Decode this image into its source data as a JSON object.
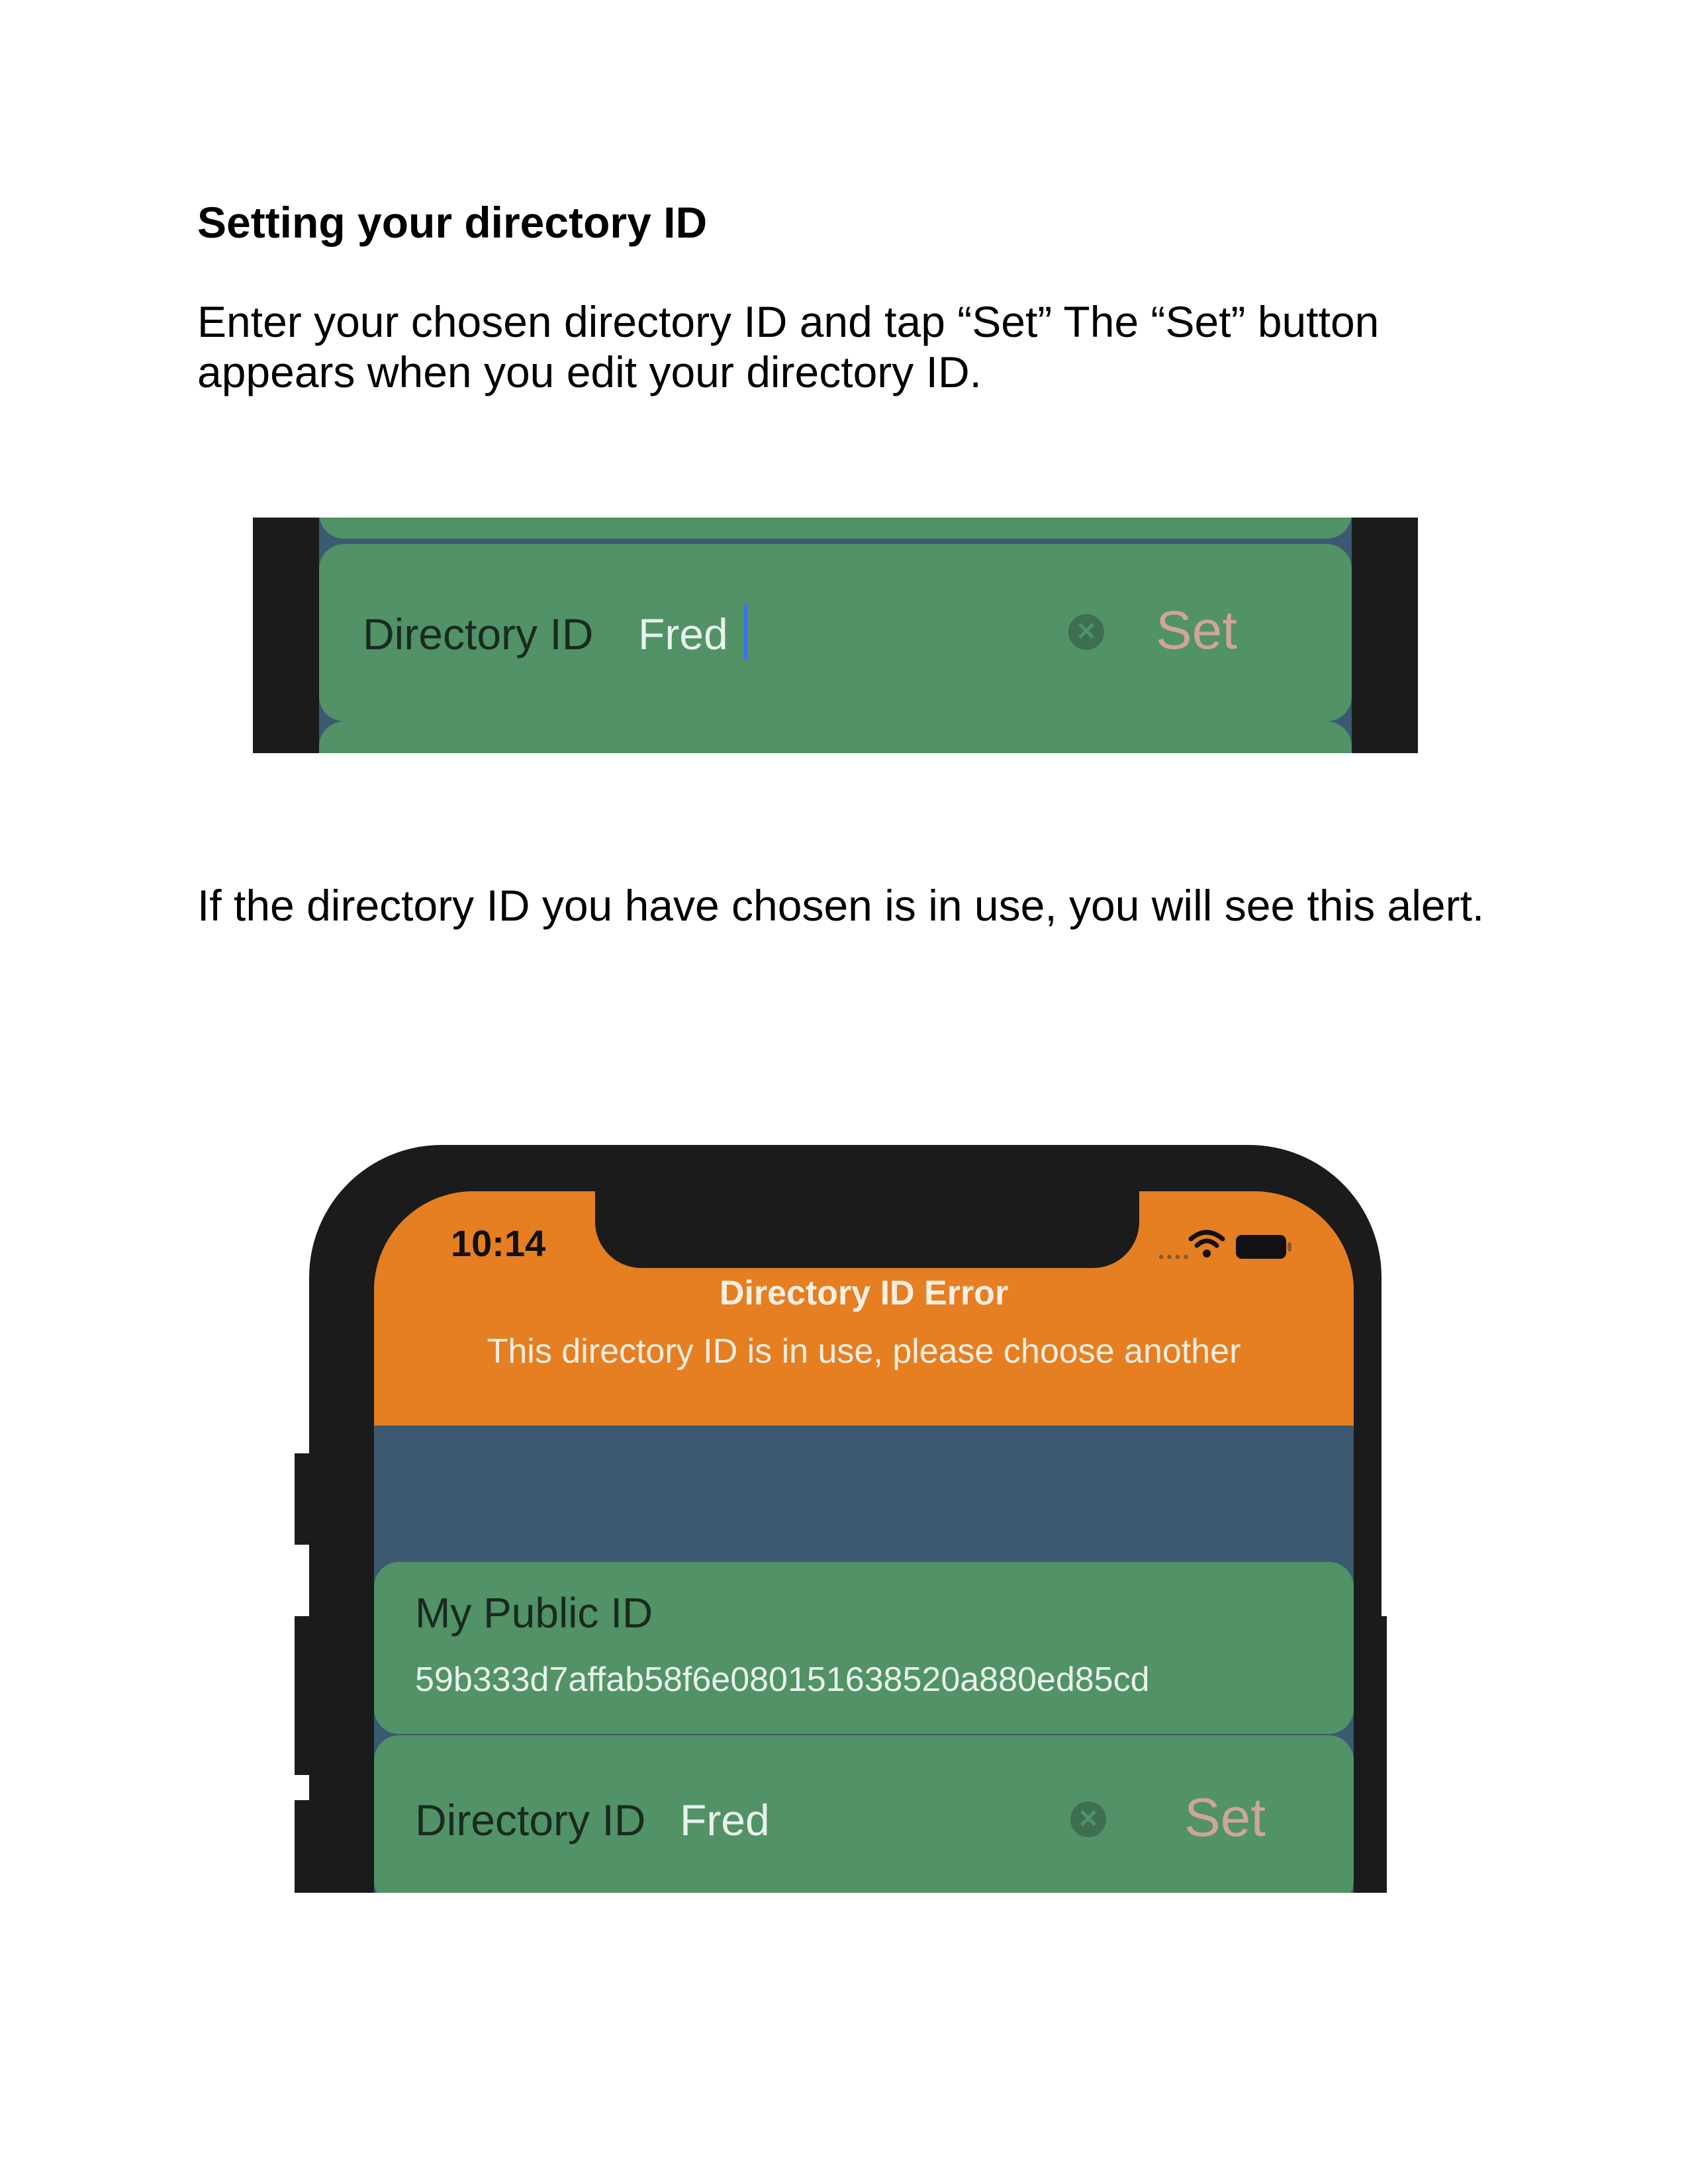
{
  "doc": {
    "heading": "Setting your directory ID",
    "paragraph1": "Enter your chosen directory ID and tap “Set” The “Set” button appears when you edit your directory ID.",
    "paragraph2": "If the directory ID you have chosen is in use, you will see this alert."
  },
  "screenshot1": {
    "directory_label": "Directory ID",
    "directory_value": "Fred",
    "set_label": "Set"
  },
  "screenshot2": {
    "status_time": "10:14",
    "alert_title": "Directory ID Error",
    "alert_message": "This directory ID is in use, please choose another",
    "public_id_label": "My Public ID",
    "public_id_value": "59b333d7affab58f6e080151638520a880ed85cd",
    "directory_label": "Directory ID",
    "directory_value": "Fred",
    "set_label": "Set"
  },
  "colors": {
    "alert_orange": "#e67e22",
    "card_green": "#519266",
    "background_blue": "#3b5a72",
    "set_button_text": "#cfa598"
  },
  "icons": [
    "clear-icon",
    "wifi-icon",
    "battery-icon",
    "cursor-caret-icon"
  ]
}
